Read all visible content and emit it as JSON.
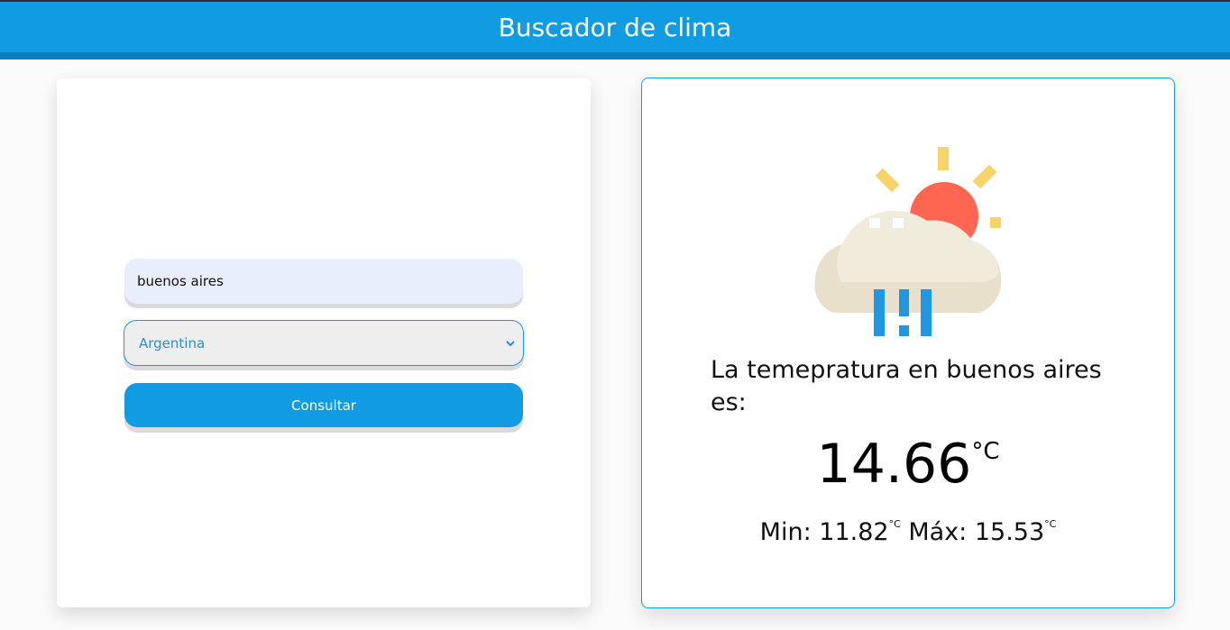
{
  "header": {
    "title": "Buscador de clima"
  },
  "form": {
    "city_value": "buenos aires",
    "country_selected": "Argentina",
    "submit_label": "Consultar"
  },
  "result": {
    "label": "La temepratura en buenos aires es:",
    "temperature": "14.66",
    "unit": "°C",
    "min_label": "Min: ",
    "min_value": "11.82",
    "min_unit": "°C",
    "max_label": "Máx: ",
    "max_value": "15.53",
    "max_unit": "°C",
    "icon": "sun-cloud-rain-icon"
  },
  "colors": {
    "primary": "#119be3",
    "header_bar": "#0a7cc0",
    "sun": "#ff6651",
    "sun_rays": "#f7d36a",
    "cloud": "#f0eadb",
    "rain": "#1e97e6"
  }
}
